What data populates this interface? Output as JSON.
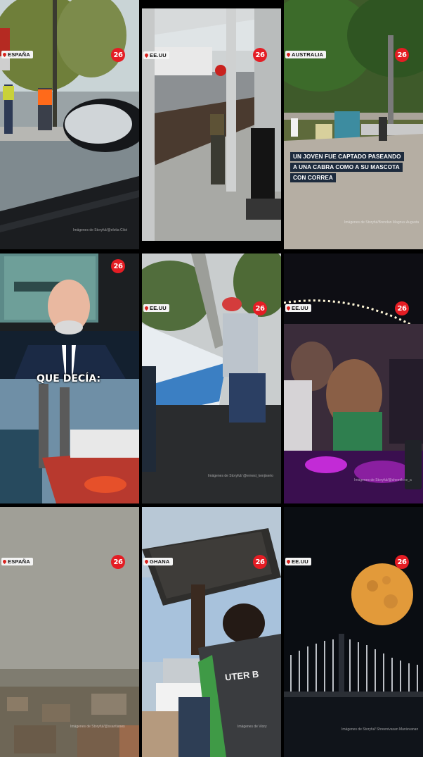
{
  "brand": {
    "logo_text": "26",
    "accent": "#e41d24"
  },
  "tiles": [
    {
      "location": "ESPAÑA",
      "credit": "Imágenes de Storyful/@elotia Cilot",
      "logo_icon": "canal-26-logo"
    },
    {
      "location": "EE.UU",
      "credit": "",
      "logo_icon": "canal-26-logo"
    },
    {
      "location": "AUSTRALIA",
      "credit": "Imágenes de Storyful/Brendan Magnus Augusta",
      "caption": [
        "UN JOVEN FUE CAPTADO PASEANDO",
        "A UNA CABRA COMO A SU MASCOTA",
        "CON CORREA"
      ]
    },
    {
      "location": "",
      "credit": "",
      "overlay_text": "QUE DECÍA:"
    },
    {
      "location": "EE.UU",
      "credit": "Imágenes de Storyful/ @ernest_kenjiserio"
    },
    {
      "location": "EE.UU",
      "credit": "Imágenes de Storyful/@shemilove_a"
    },
    {
      "location": "ESPAÑA",
      "credit": "Imágenes de Storyful/@ssantianes"
    },
    {
      "location": "GHANA",
      "credit": "Imágenes de Viory"
    },
    {
      "location": "EE.UU",
      "credit": "Imágenes de Storyful/ Shreenivasan Manievanan"
    }
  ],
  "tile4_shirt_text": "UTER B"
}
